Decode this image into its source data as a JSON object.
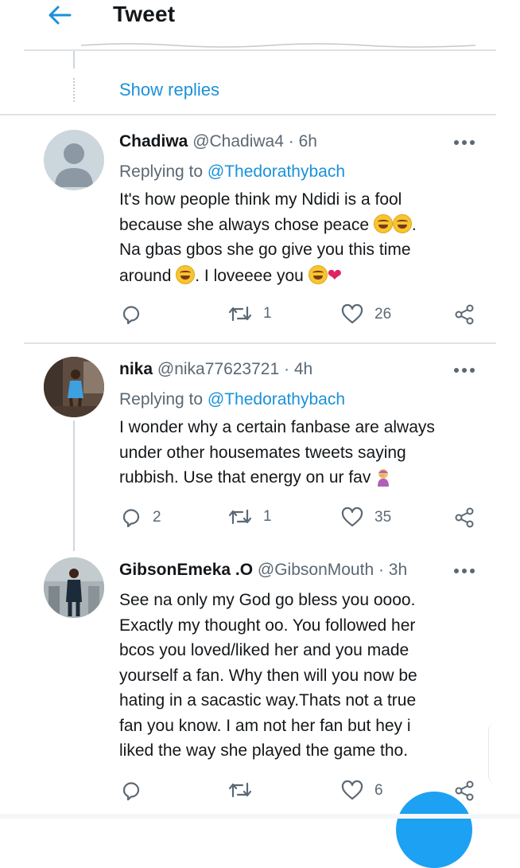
{
  "header": {
    "title": "Tweet"
  },
  "thread": {
    "show_replies": "Show replies"
  },
  "tweets": [
    {
      "name": "Chadiwa",
      "handle": "@Chadiwa4",
      "time": "· 6h",
      "replying_label": "Replying to",
      "replying_handle": "@Thedorathybach",
      "lines": [
        "It's how people think my Ndidi is a fool",
        "because she always chose peace",
        "Na gbas gbos she go give you this time",
        "around",
        ". I loveeee you"
      ],
      "reply_count": "",
      "retweet_count": "1",
      "like_count": "26"
    },
    {
      "name": "nika",
      "handle": "@nika77623721",
      "time": "· 4h",
      "replying_label": "Replying to",
      "replying_handle": "@Thedorathybach",
      "lines": [
        "I wonder why a certain fanbase are always",
        "under other housemates tweets saying",
        "rubbish. Use that energy on ur fav"
      ],
      "reply_count": "2",
      "retweet_count": "1",
      "like_count": "35"
    },
    {
      "name": "GibsonEmeka .O",
      "handle": "@GibsonMouth",
      "time": "· 3h",
      "lines": [
        "See na only my God go bless you oooo.",
        "Exactly my thought oo. You followed her",
        "bcos you loved/liked her and you made",
        "yourself a fan. Why then will you now be",
        "hating in a sacastic way.Thats not a true",
        "fan you know. I am not her fan but hey i",
        "liked the way she played the game tho."
      ],
      "reply_count": "",
      "retweet_count": "",
      "like_count": "6"
    }
  ],
  "colors": {
    "accent": "#1a91da",
    "text": "#14171a",
    "muted": "#5b6874",
    "divider": "#dfe3e8"
  },
  "icons": [
    "back-arrow-icon",
    "more-icon",
    "reply-icon",
    "retweet-icon",
    "like-icon",
    "share-icon"
  ]
}
